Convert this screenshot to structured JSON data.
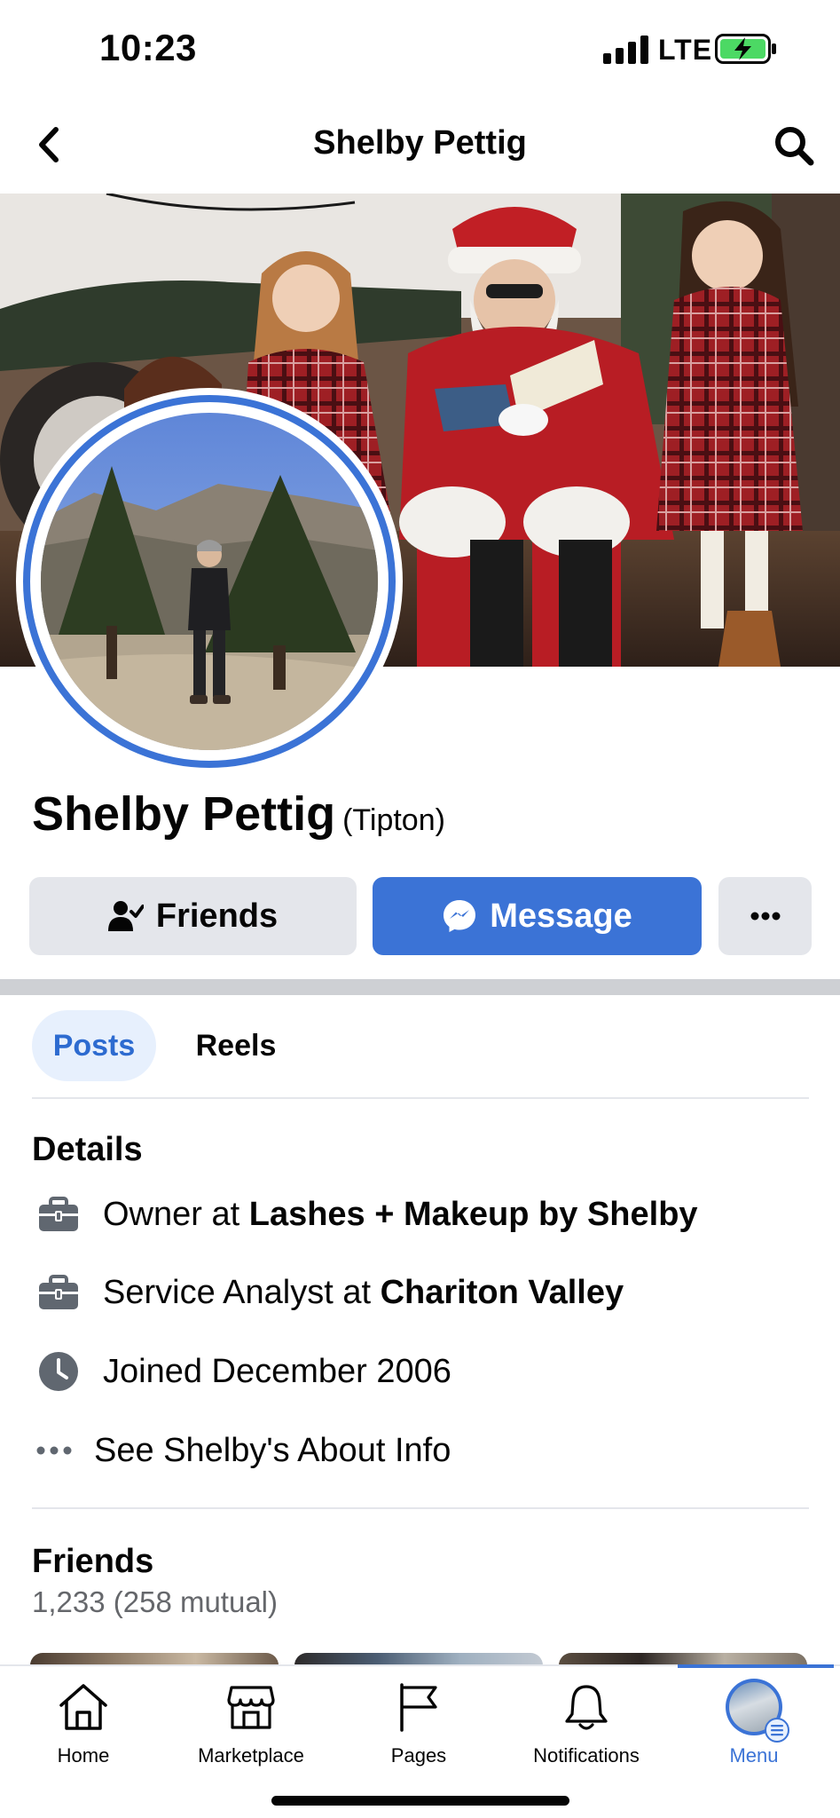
{
  "status_bar": {
    "time": "10:23",
    "network": "LTE"
  },
  "header": {
    "title": "Shelby Pettig"
  },
  "profile": {
    "name": "Shelby Pettig",
    "alt_name": "(Tipton)"
  },
  "actions": {
    "friends_label": "Friends",
    "message_label": "Message",
    "more_label": "..."
  },
  "tabs": [
    {
      "label": "Posts",
      "active": true
    },
    {
      "label": "Reels",
      "active": false
    }
  ],
  "details": {
    "title": "Details",
    "work1": {
      "prefix": "Owner at ",
      "place": "Lashes + Makeup by Shelby",
      "icon": "briefcase-icon"
    },
    "work2": {
      "prefix": "Service Analyst at ",
      "place": "Chariton Valley",
      "icon": "briefcase-icon"
    },
    "joined": {
      "text": "Joined December 2006",
      "icon": "clock-icon"
    },
    "about_link": {
      "text": "See Shelby's About Info",
      "icon": "more-dots-icon"
    }
  },
  "friends": {
    "title": "Friends",
    "count": "1,233 (258 mutual)"
  },
  "tab_bar": {
    "items": [
      {
        "label": "Home",
        "icon": "home-icon"
      },
      {
        "label": "Marketplace",
        "icon": "marketplace-icon"
      },
      {
        "label": "Pages",
        "icon": "flag-icon"
      },
      {
        "label": "Notifications",
        "icon": "bell-icon"
      },
      {
        "label": "Menu",
        "icon": "menu-avatar-icon",
        "active": true
      }
    ]
  },
  "colors": {
    "accent": "#3b73d6",
    "button_gray": "#e4e6eb",
    "active_tab_bg": "#e7f0fd",
    "secondary_text": "#65676b"
  }
}
